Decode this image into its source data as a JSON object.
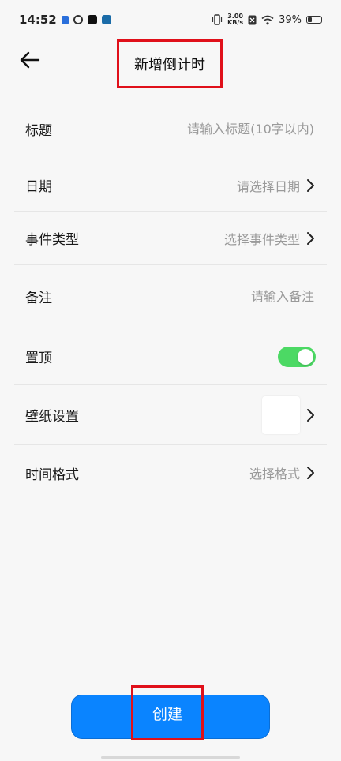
{
  "status_bar": {
    "time": "14:52",
    "net_speed_value": "3.00",
    "net_speed_unit": "KB/s",
    "battery_percent": "39%",
    "battery_level": 0.39
  },
  "header": {
    "title": "新增倒计时"
  },
  "form": {
    "title": {
      "label": "标题",
      "placeholder": "请输入标题(10字以内)"
    },
    "date": {
      "label": "日期",
      "value": "请选择日期"
    },
    "event_type": {
      "label": "事件类型",
      "value": "选择事件类型"
    },
    "note": {
      "label": "备注",
      "placeholder": "请输入备注"
    },
    "pin": {
      "label": "置顶",
      "on": true
    },
    "wallpaper": {
      "label": "壁纸设置"
    },
    "time_format": {
      "label": "时间格式",
      "value": "选择格式"
    }
  },
  "create_button": {
    "label": "创建"
  },
  "colors": {
    "accent": "#0a84ff",
    "toggle_on": "#4cd964",
    "highlight": "#e0101a"
  }
}
